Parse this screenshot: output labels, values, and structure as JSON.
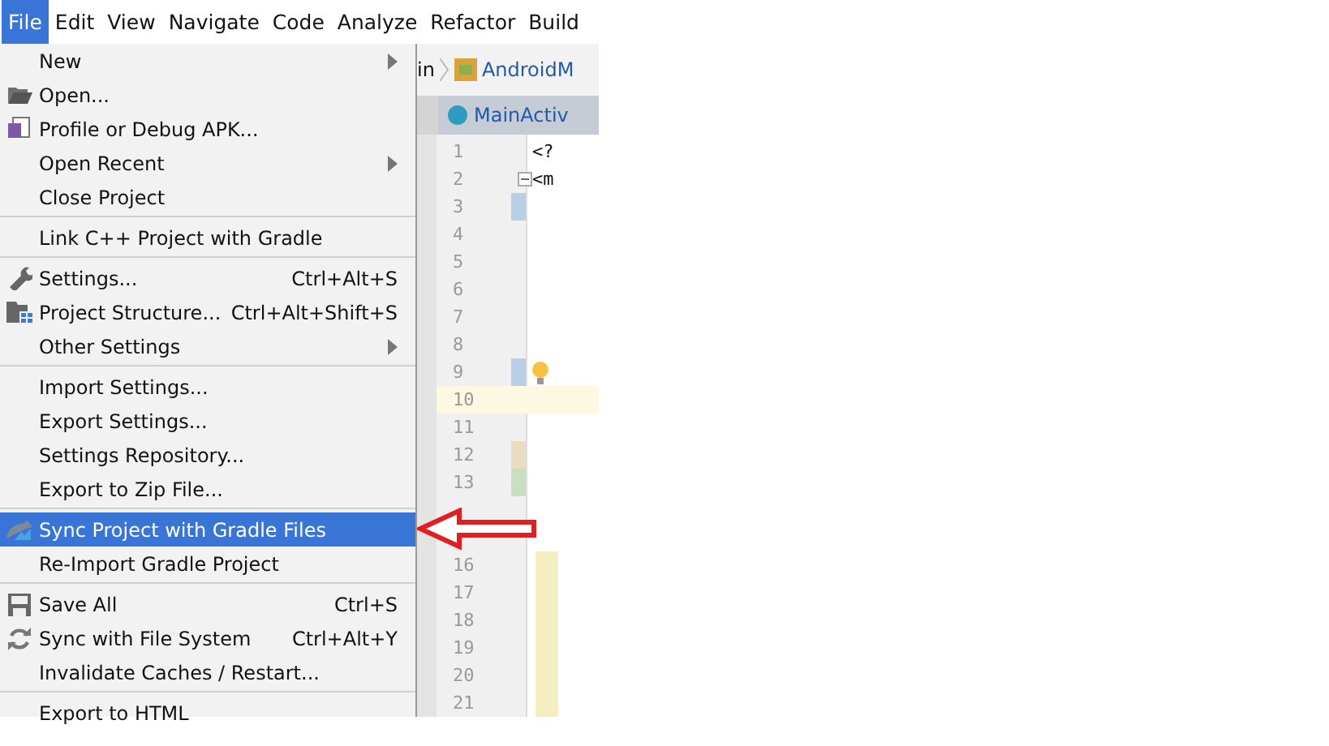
{
  "menu_bar": [
    {
      "label": "File",
      "selected": true
    },
    {
      "label": "Edit",
      "selected": false
    },
    {
      "label": "View",
      "selected": false
    },
    {
      "label": "Navigate",
      "selected": false
    },
    {
      "label": "Code",
      "selected": false
    },
    {
      "label": "Analyze",
      "selected": false
    },
    {
      "label": "Refactor",
      "selected": false
    },
    {
      "label": "Build",
      "selected": false
    }
  ],
  "breadcrumb": {
    "segment": "in",
    "file": "AndroidM"
  },
  "editor_tab": {
    "label": "MainActiv"
  },
  "file_menu": [
    {
      "kind": "item",
      "label": "New",
      "submenu": true,
      "selected": false
    },
    {
      "kind": "item",
      "label": "Open...",
      "selected": false
    },
    {
      "kind": "item",
      "label": "Profile or Debug APK...",
      "selected": false
    },
    {
      "kind": "item",
      "label": "Open Recent",
      "submenu": true,
      "selected": false
    },
    {
      "kind": "item",
      "label": "Close Project",
      "selected": false
    },
    {
      "kind": "separator"
    },
    {
      "kind": "item",
      "label": "Link C++ Project with Gradle",
      "selected": false
    },
    {
      "kind": "separator"
    },
    {
      "kind": "item",
      "label": "Settings...",
      "shortcut": "Ctrl+Alt+S",
      "selected": false
    },
    {
      "kind": "item",
      "label": "Project Structure...",
      "shortcut": "Ctrl+Alt+Shift+S",
      "selected": false
    },
    {
      "kind": "item",
      "label": "Other Settings",
      "submenu": true,
      "selected": false
    },
    {
      "kind": "separator"
    },
    {
      "kind": "item",
      "label": "Import Settings...",
      "selected": false
    },
    {
      "kind": "item",
      "label": "Export Settings...",
      "selected": false
    },
    {
      "kind": "item",
      "label": "Settings Repository...",
      "selected": false
    },
    {
      "kind": "item",
      "label": "Export to Zip File...",
      "selected": false
    },
    {
      "kind": "separator"
    },
    {
      "kind": "item",
      "label": "Sync Project with Gradle Files",
      "selected": true
    },
    {
      "kind": "item",
      "label": "Re-Import Gradle Project",
      "selected": false
    },
    {
      "kind": "separator"
    },
    {
      "kind": "item",
      "label": "Save All",
      "shortcut": "Ctrl+S",
      "selected": false
    },
    {
      "kind": "item",
      "label": "Sync with File System",
      "shortcut": "Ctrl+Alt+Y",
      "selected": false
    },
    {
      "kind": "item",
      "label": "Invalidate Caches / Restart...",
      "selected": false
    },
    {
      "kind": "separator"
    },
    {
      "kind": "item",
      "label": "Export to HTML",
      "selected": false
    }
  ],
  "editor_lines": [
    {
      "number": "1",
      "code": "<?"
    },
    {
      "number": "2",
      "code": "<m",
      "fold": true
    },
    {
      "number": "3",
      "color": "#b9cfe4"
    },
    {
      "number": "4"
    },
    {
      "number": "5"
    },
    {
      "number": "6"
    },
    {
      "number": "7"
    },
    {
      "number": "8"
    },
    {
      "number": "9",
      "color": "#b9cfe4",
      "bulb": true
    },
    {
      "number": "10",
      "current": true
    },
    {
      "number": "11"
    },
    {
      "number": "12",
      "color": "#e9dcc0"
    },
    {
      "number": "13",
      "color": "#c9dfc2"
    }
  ],
  "editor_lines_below_arrow": [
    {
      "number": "16",
      "highlight": true
    },
    {
      "number": "17",
      "highlight": true
    },
    {
      "number": "18",
      "highlight": true
    },
    {
      "number": "19",
      "highlight": true
    },
    {
      "number": "20",
      "highlight": true
    },
    {
      "number": "21",
      "highlight": true
    }
  ]
}
